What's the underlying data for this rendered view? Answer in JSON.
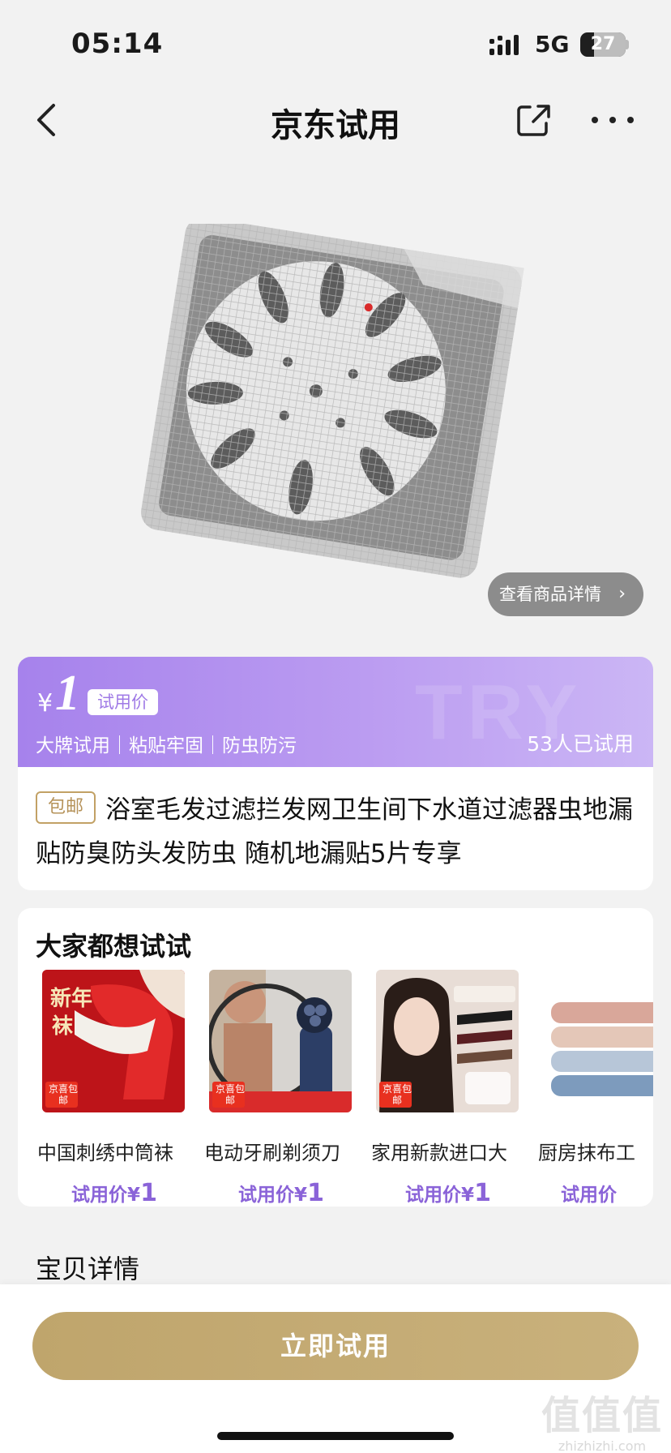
{
  "status_bar": {
    "time": "05:14",
    "network": "5G",
    "battery": "27"
  },
  "nav": {
    "title": "京东试用"
  },
  "product": {
    "detail_link": "查看商品详情"
  },
  "trial": {
    "currency": "¥",
    "price": "1",
    "price_tag": "试用价",
    "features": "大牌试用｜粘贴牢固｜防虫防污",
    "tried_count": "53人已试用",
    "watermark": "TRY"
  },
  "listing": {
    "shipping_badge": "包邮",
    "title": "浴室毛发过滤拦发网卫生间下水道过滤器虫地漏贴防臭防头发防虫 随机地漏贴5片专享"
  },
  "recommendations": {
    "title": "大家都想试试",
    "items": [
      {
        "name": "中国刺绣中筒袜",
        "price_label": "试用价¥",
        "price": "1",
        "badge": "京喜包邮"
      },
      {
        "name": "电动牙刷剃须刀",
        "price_label": "试用价¥",
        "price": "1",
        "badge": "京喜包邮"
      },
      {
        "name": "家用新款进口大",
        "price_label": "试用价¥",
        "price": "1",
        "badge": "京喜包邮"
      },
      {
        "name": "厨房抹布工",
        "price_label": "试用价",
        "price": "",
        "badge": ""
      }
    ]
  },
  "details": {
    "title": "宝贝详情"
  },
  "cta": {
    "label": "立即试用"
  },
  "watermark": {
    "big": "值值值",
    "small": "zhizhizhi.com"
  },
  "colors": {
    "accent_purple": "#a682ec",
    "gold": "#c2a66e",
    "price_purple": "#8a63d8"
  }
}
